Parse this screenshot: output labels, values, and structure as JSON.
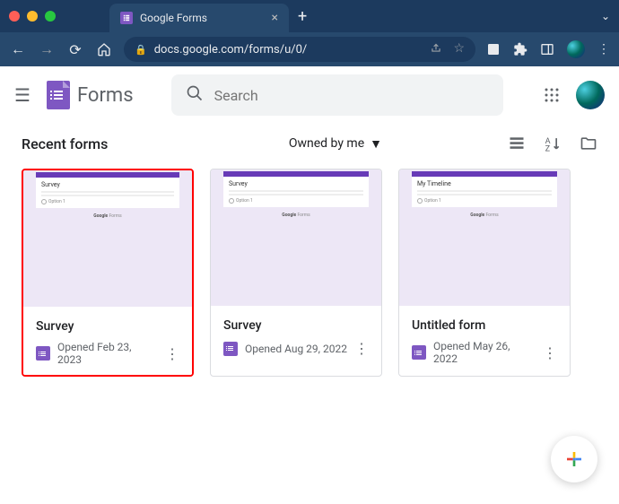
{
  "browser": {
    "tab_title": "Google Forms",
    "url": "docs.google.com/forms/u/0/"
  },
  "app": {
    "name": "Forms",
    "search_placeholder": "Search"
  },
  "section": {
    "title": "Recent forms",
    "filter_label": "Owned by me"
  },
  "cards": [
    {
      "title": "Survey",
      "date": "Opened Feb 23, 2023",
      "thumb_title": "Survey",
      "highlighted": true
    },
    {
      "title": "Survey",
      "date": "Opened Aug 29, 2022",
      "thumb_title": "Survey",
      "highlighted": false
    },
    {
      "title": "Untitled form",
      "date": "Opened May 26, 2022",
      "thumb_title": "My Timeline",
      "highlighted": false
    }
  ],
  "thumb_footer_brand": "Google",
  "thumb_footer_suffix": " Forms"
}
